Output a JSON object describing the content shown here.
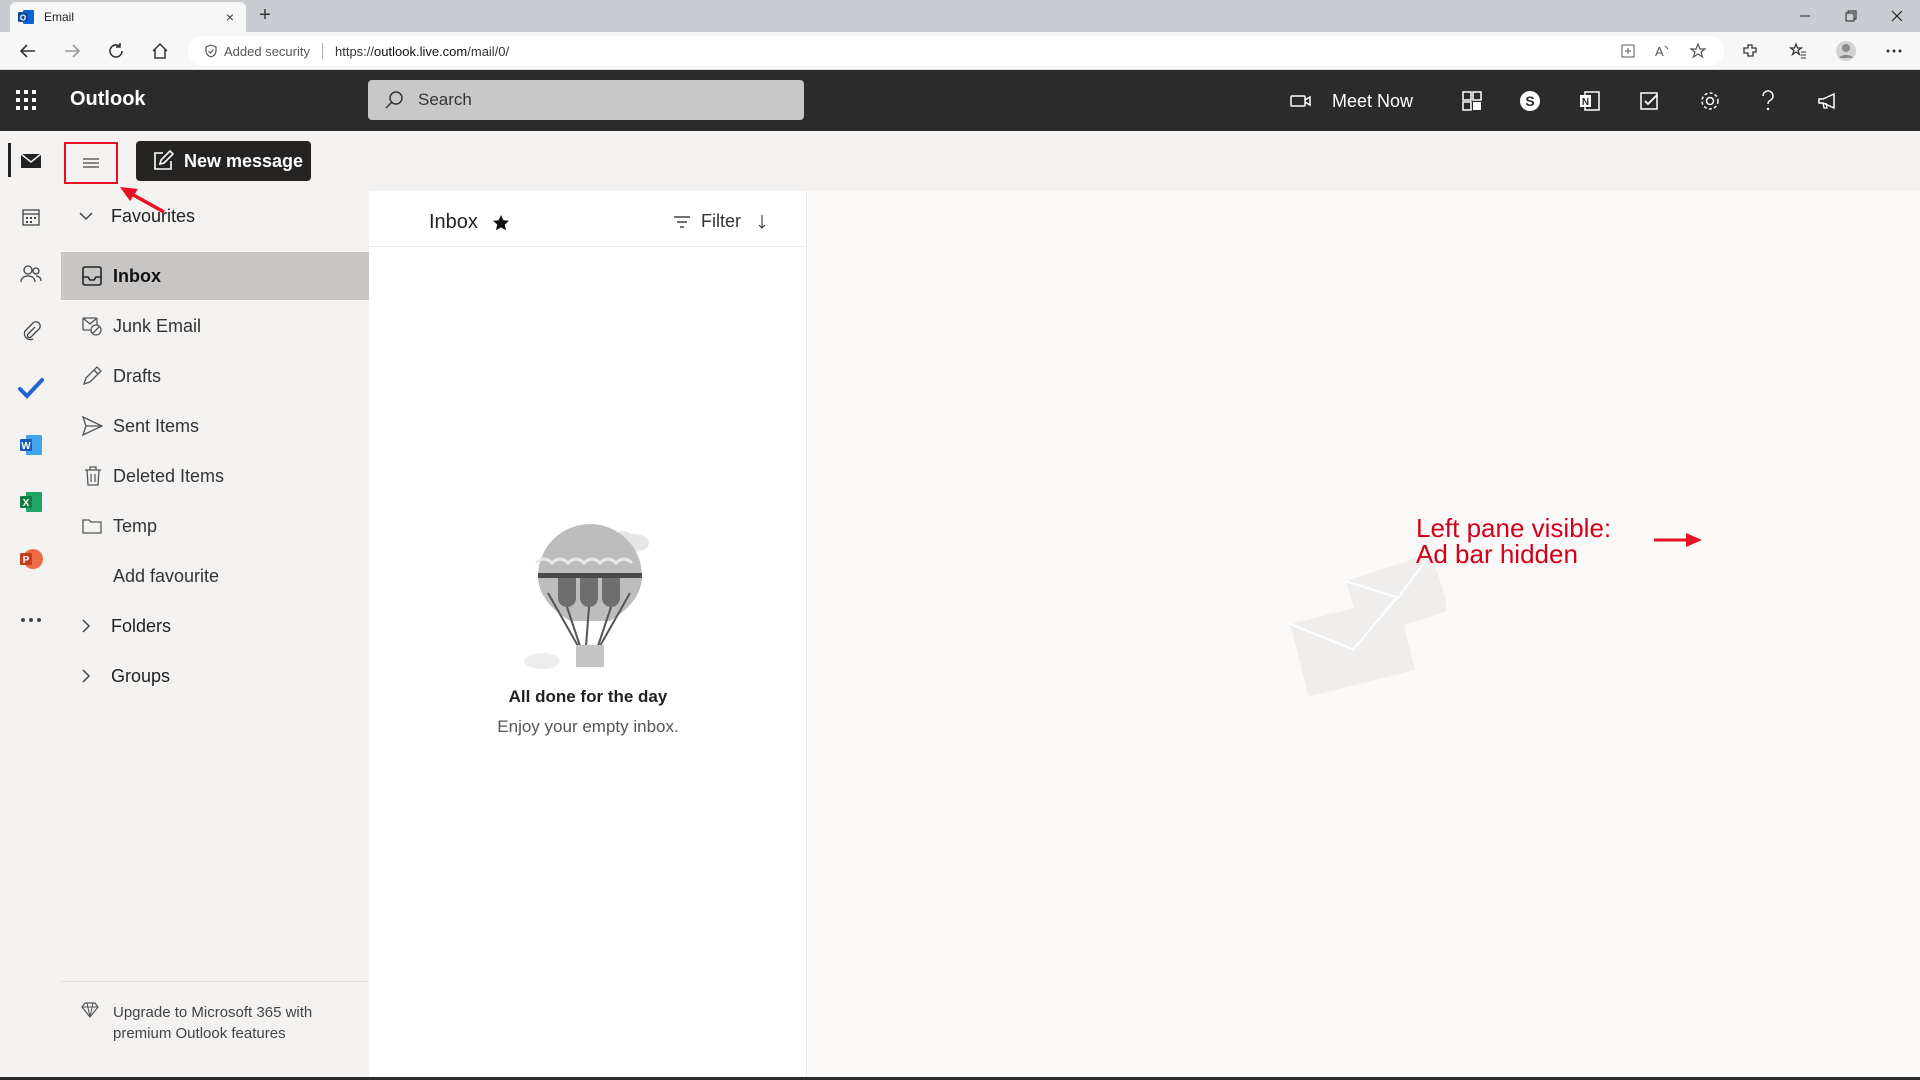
{
  "browser": {
    "tab_title": "Email",
    "tab_close": "×",
    "new_tab": "+",
    "security_label": "Added security",
    "url_prefix": "https://",
    "url_host": "outlook.live.com",
    "url_path": "/mail/0/"
  },
  "header": {
    "brand": "Outlook",
    "search_placeholder": "Search",
    "meet_now": "Meet Now"
  },
  "commands": {
    "new_message": "New message"
  },
  "folders": {
    "favourites_label": "Favourites",
    "items": [
      {
        "label": "Inbox",
        "icon": "inbox-icon",
        "selected": true
      },
      {
        "label": "Junk Email",
        "icon": "junk-icon"
      },
      {
        "label": "Drafts",
        "icon": "pencil-icon"
      },
      {
        "label": "Sent Items",
        "icon": "send-icon"
      },
      {
        "label": "Deleted Items",
        "icon": "trash-icon"
      },
      {
        "label": "Temp",
        "icon": "folder-icon"
      },
      {
        "label": "Add favourite",
        "icon": ""
      }
    ],
    "folders_label": "Folders",
    "groups_label": "Groups",
    "upgrade_text": "Upgrade to Microsoft 365 with premium Outlook features"
  },
  "message_list": {
    "title": "Inbox",
    "filter": "Filter",
    "empty_title": "All done for the day",
    "empty_subtitle": "Enjoy your empty inbox."
  },
  "annotation": {
    "line1": "Left pane visible:",
    "line2": "Ad bar hidden"
  },
  "colors": {
    "header_bg": "#2b2b2b",
    "annotation_red": "#d4001b",
    "selected_bg": "#c8c6c4"
  }
}
